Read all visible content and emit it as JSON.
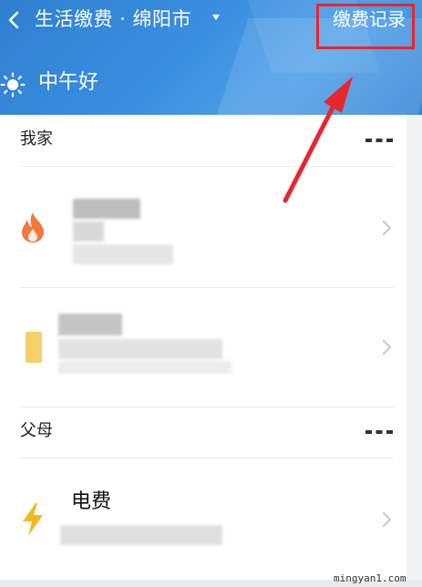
{
  "header": {
    "title": "生活缴费 · 绵阳市",
    "records_label": "缴费记录",
    "greeting": "中午好",
    "back_icon": "chevron-left-icon",
    "sun_icon": "sun-icon",
    "accent": "#3b8fe0",
    "highlight_color": "#e8262d"
  },
  "groups": [
    {
      "title": "我家",
      "more_icon": "ellipsis-icon",
      "items": [
        {
          "icon": "flame-icon",
          "icon_color": "#f07a3c"
        },
        {
          "icon": "card-icon",
          "icon_color": "#f5d06a"
        }
      ]
    },
    {
      "title": "父母",
      "more_icon": "ellipsis-icon",
      "items": [
        {
          "icon": "lightning-icon",
          "icon_color": "#f5b81c",
          "title": "电费"
        }
      ]
    }
  ],
  "watermark": "mingyan1.com"
}
